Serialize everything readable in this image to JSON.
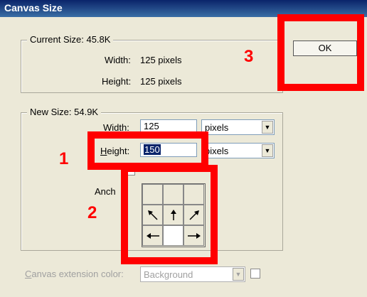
{
  "window": {
    "title": "Canvas Size"
  },
  "current_size": {
    "legend": "Current Size: 45.8K",
    "width_label": "Width:",
    "width_value": "125 pixels",
    "height_label": "Height:",
    "height_value": "125 pixels"
  },
  "new_size": {
    "legend": "New Size: 54.9K",
    "width_label_u": "W",
    "width_label_rest": "idth:",
    "width_value": "125",
    "width_unit": "pixels",
    "height_label_u": "H",
    "height_label_rest": "eight:",
    "height_value": "150",
    "height_unit": "pixels",
    "anchor_label": "Anch"
  },
  "canvas_extension": {
    "label_u": "C",
    "label_rest": "anvas extension color:",
    "value": "Background"
  },
  "buttons": {
    "ok": "OK"
  },
  "annotations": {
    "one": "1",
    "two": "2",
    "three": "3"
  },
  "colors": {
    "annotation": "#ff0000",
    "titlebar": "#0a246a"
  }
}
